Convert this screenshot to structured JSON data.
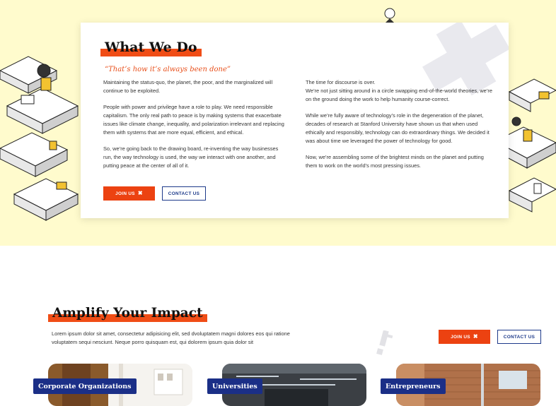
{
  "about": {
    "heading": "What We Do",
    "quote": "“That’s how it’s always been done”",
    "left_paragraphs": [
      "Maintaining the status-quo, the planet, the poor, and the marginalized will continue to be exploited.",
      "People with power and privilege have a role to play. We need responsible capitalism. The only real path to peace is by making systems that exacerbate issues like climate change, inequality, and polarization irrelevant and replacing them with systems that are more equal, efficient, and ethical.",
      "So, we’re going back to the drawing board, re-inventing the way businesses run, the way technology is used, the way we interact with one another, and putting peace at the center of all of it."
    ],
    "right_paragraphs": [
      "The time for discourse is over.\nWe’re not just sitting around in a circle swapping end-of-the-world theories, we’re on the ground doing the work to help humanity course-correct.",
      "While we’re fully aware of technology’s role in the degeneration of the planet, decades of research at Stanford University have shown us that when used ethically and responsibly, technology can do extraordinary things. We decided it was about time we leveraged the power of technology for good.",
      "Now, we’re assembling some of the brightest minds on the planet and putting them to work on the world’s most pressing issues."
    ],
    "join_label": "JOIN US",
    "contact_label": "CONTACT US"
  },
  "impact": {
    "heading": "Amplify Your Impact",
    "lead": "Lorem ipsum dolor sit amet, consectetur adipisicing elit, sed dvoluptatem magni dolores eos qui ratione voluptatem sequi nesciunt. Neque porro quisquam est, qui dolorem ipsum quia dolor sit",
    "join_label": "JOIN US",
    "contact_label": "CONTACT US"
  },
  "tiles": [
    {
      "label": "Corporate Organizations"
    },
    {
      "label": "Universities"
    },
    {
      "label": "Entrepreneurs"
    }
  ],
  "icons": {
    "join": "close-x-icon"
  },
  "colors": {
    "hero_bg": "#fffbcd",
    "accent": "#ec4211",
    "navy": "#1b2f87"
  }
}
